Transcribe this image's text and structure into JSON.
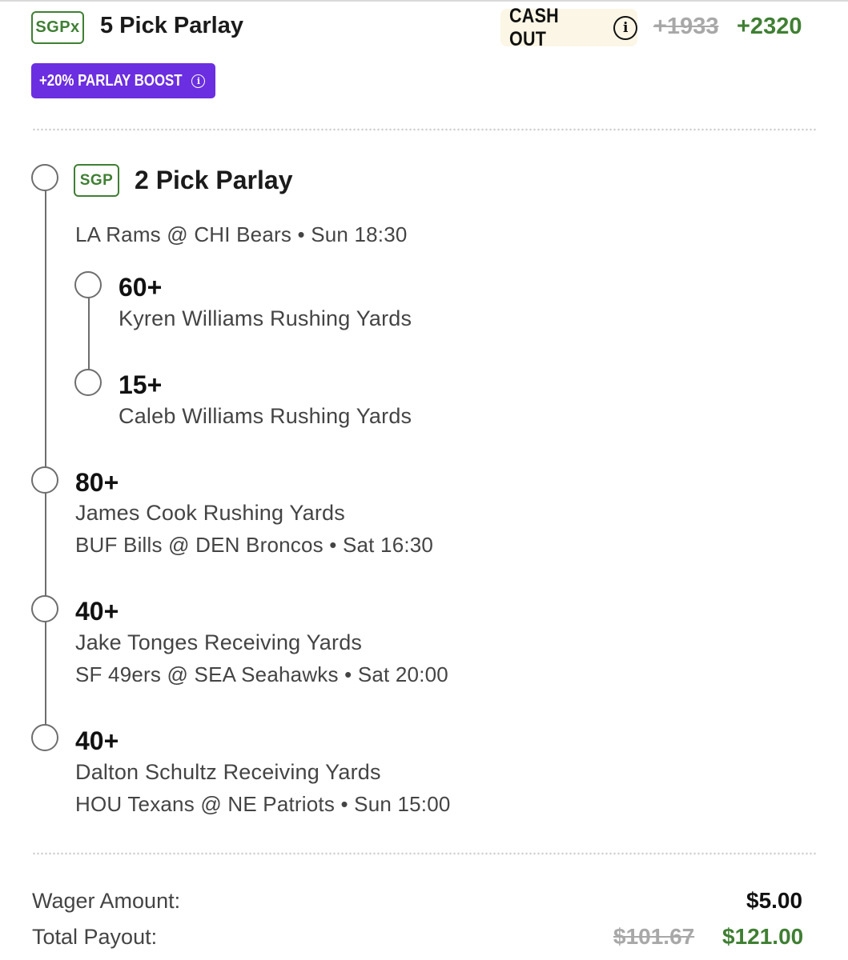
{
  "header": {
    "badge": "SGPx",
    "title": "5 Pick Parlay",
    "cashout_label": "CASH OUT",
    "info_glyph": "i",
    "odds_old": "+1933",
    "odds_new": "+2320",
    "boost_label": "+20% PARLAY BOOST",
    "boost_info_glyph": "i"
  },
  "sgp_group": {
    "badge": "SGP",
    "title": "2 Pick Parlay",
    "game": "LA Rams @ CHI Bears • Sun 18:30",
    "picks": [
      {
        "line": "60+",
        "market": "Kyren Williams Rushing Yards"
      },
      {
        "line": "15+",
        "market": "Caleb Williams Rushing Yards"
      }
    ]
  },
  "legs": [
    {
      "line": "80+",
      "market": "James Cook Rushing Yards",
      "game": "BUF Bills @ DEN Broncos • Sat 16:30"
    },
    {
      "line": "40+",
      "market": "Jake Tonges Receiving Yards",
      "game": "SF 49ers @ SEA Seahawks • Sat 20:00"
    },
    {
      "line": "40+",
      "market": "Dalton Schultz Receiving Yards",
      "game": "HOU Texans @ NE Patriots • Sun 15:00"
    }
  ],
  "footer": {
    "wager_label": "Wager Amount:",
    "wager_value": "$5.00",
    "payout_label": "Total Payout:",
    "payout_old": "$101.67",
    "payout_new": "$121.00"
  },
  "colors": {
    "accent_green": "#3f7f33",
    "boost_purple": "#6b2ee0",
    "cashout_bg": "#fbf6e6"
  },
  "icons": [
    "info-icon",
    "timeline-node-icon"
  ]
}
